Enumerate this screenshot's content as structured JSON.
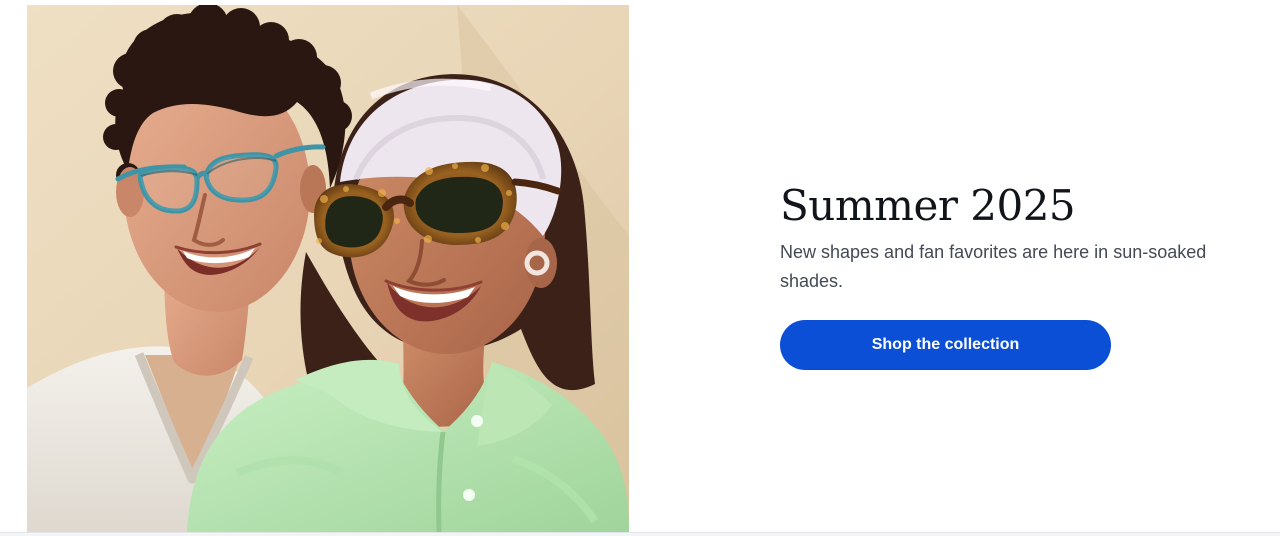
{
  "hero": {
    "image_alt": "Two people smiling, one wearing blue-rimmed glasses and one wearing tortoiseshell sunglasses",
    "title": "Summer 2025",
    "subtitle": "New shapes and fan favorites are here in sun-soaked shades.",
    "cta_label": "Shop the collection"
  },
  "colors": {
    "cta_background": "#0b4fd6",
    "cta_text": "#ffffff",
    "title": "#111418",
    "subtitle": "#434a53",
    "photo_background": "#ead9bd"
  }
}
